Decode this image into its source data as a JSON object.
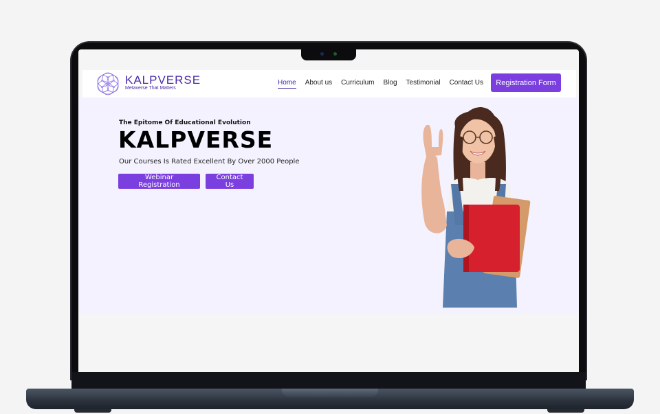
{
  "site": {
    "brand": "KALPVERSE",
    "tagline": "Metaverse That Matters"
  },
  "nav": {
    "links": [
      {
        "label": "Home",
        "active": true
      },
      {
        "label": "About us"
      },
      {
        "label": "Curriculum"
      },
      {
        "label": "Blog"
      },
      {
        "label": "Testimonial"
      },
      {
        "label": "Contact Us"
      }
    ],
    "cta_label": "Registration Form"
  },
  "hero": {
    "eyebrow": "The Epitome Of Educational Evolution",
    "title": "KALPVERSE",
    "subtitle": "Our Courses Is Rated Excellent By Over 2000 People",
    "primary_button": "Webinar Registration",
    "secondary_button": "Contact Us",
    "image_icon": "student-with-books-photo"
  },
  "colors": {
    "accent": "#7b3fe0",
    "brand": "#4b2aa8",
    "hero_bg": "#f4f2fe"
  }
}
